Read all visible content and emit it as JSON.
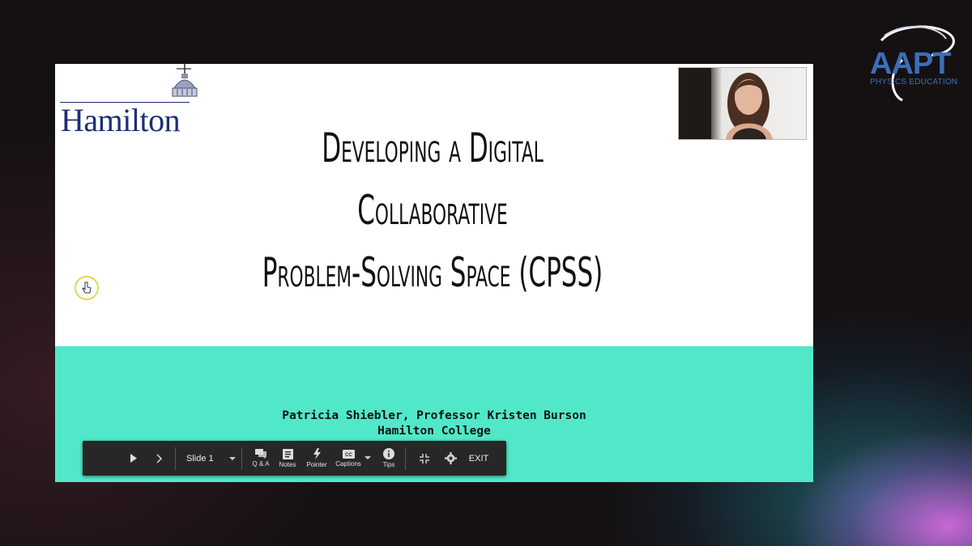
{
  "aapt_logo": {
    "text": "AAPT",
    "subtitle": "PHYSICS EDUCATION",
    "color": "#3b6fb8"
  },
  "slide": {
    "logo": {
      "wordmark": "Hamilton",
      "color": "#1c2e78"
    },
    "title_lines": [
      "Developing a Digital",
      "Collaborative",
      "Problem-Solving Space (CPSS)"
    ],
    "authors": "Patricia Shiebler, Professor Kristen Burson",
    "institution": "Hamilton College",
    "band_color": "#51e8c9"
  },
  "toolbar": {
    "play_icon": "play-icon",
    "next_icon": "chevron-right-icon",
    "slide_select": "Slide 1",
    "items": [
      {
        "label": "Q & A",
        "icon": "chat-icon"
      },
      {
        "label": "Notes",
        "icon": "notes-icon"
      },
      {
        "label": "Pointer",
        "icon": "pointer-icon"
      },
      {
        "label": "Captions",
        "icon": "captions-icon"
      },
      {
        "label": "Tips",
        "icon": "info-icon"
      }
    ],
    "exit_label": "EXIT"
  }
}
